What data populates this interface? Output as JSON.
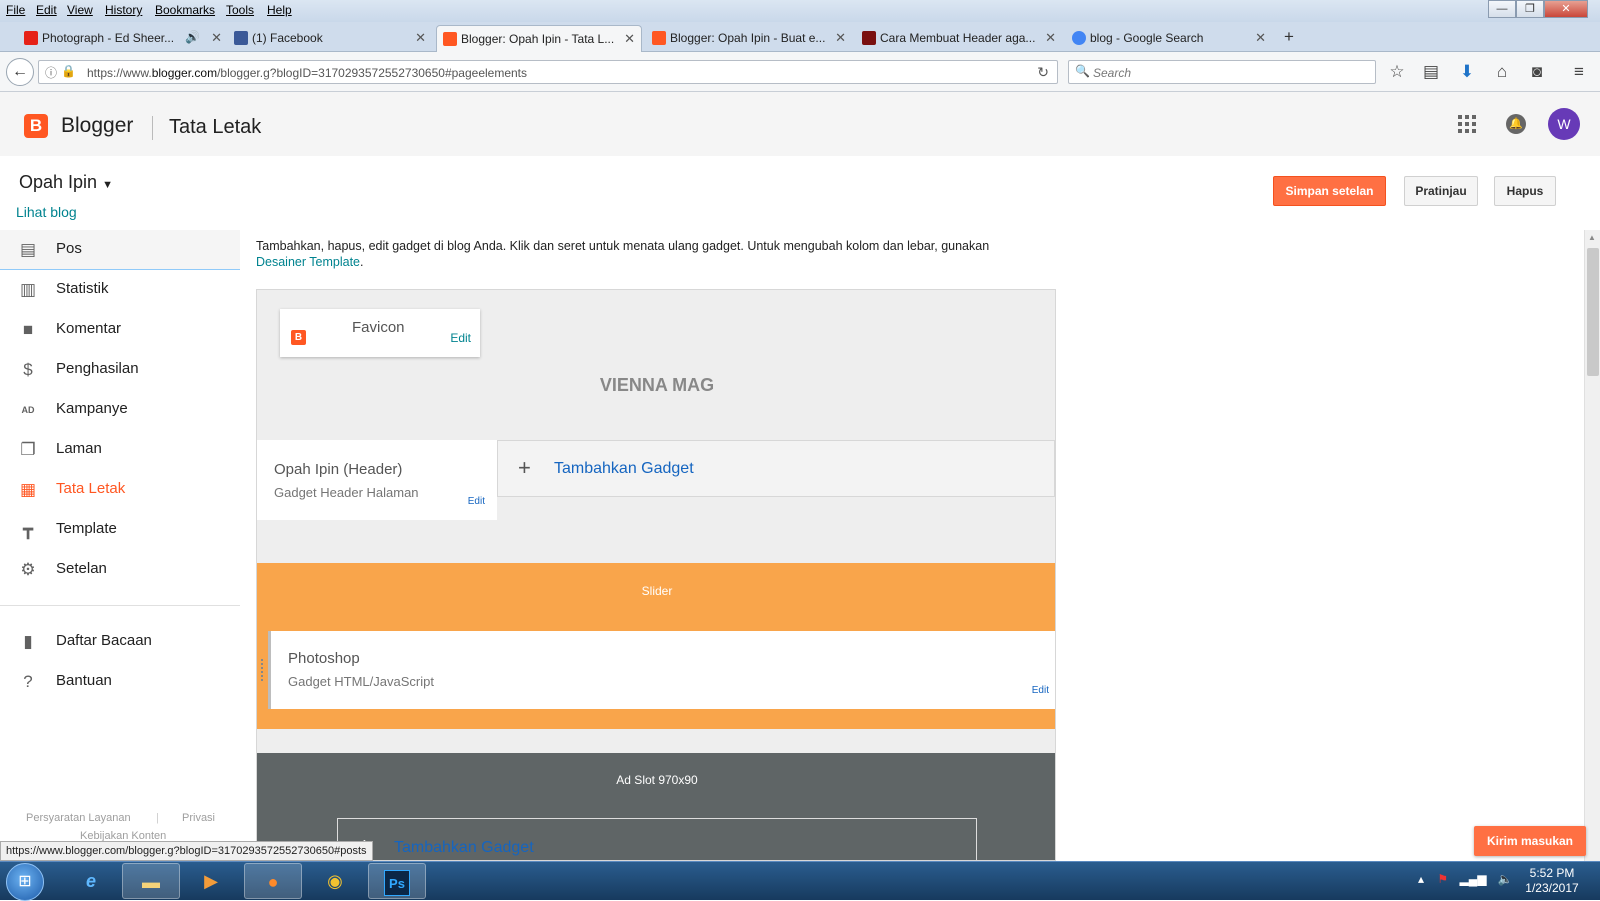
{
  "browser": {
    "menu": [
      "File",
      "Edit",
      "View",
      "History",
      "Bookmarks",
      "Tools",
      "Help"
    ],
    "window_controls": {
      "minimize": "—",
      "restore": "❐",
      "close": "✕"
    },
    "tabs": [
      {
        "label": "Photograph - Ed Sheer...",
        "icon": "youtube-icon",
        "color": "#e62117"
      },
      {
        "label": "(1) Facebook",
        "icon": "facebook-icon",
        "color": "#3b5998"
      },
      {
        "label": "Blogger: Opah Ipin - Tata L...",
        "icon": "blogger-icon",
        "color": "#ff5722"
      },
      {
        "label": "Blogger: Opah Ipin - Buat e...",
        "icon": "blogger-icon",
        "color": "#ff5722"
      },
      {
        "label": "Cara Membuat Header aga...",
        "icon": "site-icon",
        "color": "#7a1010"
      },
      {
        "label": "blog - Google Search",
        "icon": "google-icon",
        "color": "#4285f4"
      }
    ],
    "new_tab": "+",
    "url_prefix": "https://www.",
    "url_domain": "blogger.com",
    "url_rest": "/blogger.g?blogID=3170293572552730650#pageelements",
    "search_placeholder": "Search",
    "status_url": "https://www.blogger.com/blogger.g?blogID=3170293572552730650#posts"
  },
  "header": {
    "brand": "Blogger",
    "title": "Tata Letak",
    "avatar_initial": "W",
    "accent": "#ff5722"
  },
  "sidebar": {
    "blog_name": "Opah Ipin",
    "view_blog": "Lihat blog",
    "items": [
      {
        "label": "Pos",
        "icon": "posts-icon"
      },
      {
        "label": "Statistik",
        "icon": "stats-icon"
      },
      {
        "label": "Komentar",
        "icon": "comment-icon"
      },
      {
        "label": "Penghasilan",
        "icon": "dollar-icon"
      },
      {
        "label": "Kampanye",
        "icon": "ad-icon"
      },
      {
        "label": "Laman",
        "icon": "pages-icon"
      },
      {
        "label": "Tata Letak",
        "icon": "layout-icon"
      },
      {
        "label": "Template",
        "icon": "paint-roller-icon"
      },
      {
        "label": "Setelan",
        "icon": "gear-icon"
      }
    ],
    "secondary": [
      {
        "label": "Daftar Bacaan",
        "icon": "bookmark-icon"
      },
      {
        "label": "Bantuan",
        "icon": "help-icon"
      }
    ],
    "footer": {
      "terms": "Persyaratan Layanan",
      "privacy": "Privasi",
      "content_policy": "Kebijakan Konten"
    }
  },
  "toolbar": {
    "save_label": "Simpan setelan",
    "preview_label": "Pratinjau",
    "delete_label": "Hapus"
  },
  "main": {
    "instructions": "Tambahkan, hapus, edit gadget di blog Anda. Klik dan seret untuk menata ulang gadget. Untuk mengubah kolom dan lebar, gunakan",
    "designer_link": "Desainer Template",
    "favicon": {
      "title": "Favicon",
      "edit": "Edit"
    },
    "site_title": "VIENNA MAG",
    "header_gadget": {
      "title": "Opah Ipin (Header)",
      "subtitle": "Gadget Header Halaman",
      "edit": "Edit"
    },
    "add_gadget": "Tambahkan Gadget",
    "slider_label": "Slider",
    "photoshop_gadget": {
      "title": "Photoshop",
      "subtitle": "Gadget HTML/JavaScript",
      "edit": "Edit"
    },
    "adslot_label": "Ad Slot 970x90"
  },
  "feedback_label": "Kirim masukan",
  "taskbar": {
    "time": "5:52 PM",
    "date": "1/23/2017"
  }
}
